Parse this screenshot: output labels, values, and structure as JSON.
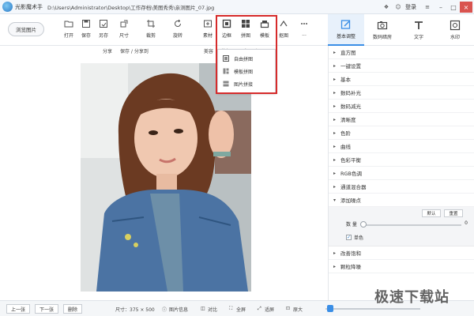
{
  "titlebar": {
    "app_name": "光影魔术手",
    "file_path": "D:\\Users\\Administrator\\Desktop\\工作存档\\美图秀秀\\亲测图片_07.jpg",
    "login": "登录",
    "minimize": "–",
    "maximize": "□",
    "close": "×"
  },
  "toolbar": {
    "browse_button": "浏览图片",
    "tools": [
      {
        "label": "打开",
        "icon": "folder-icon"
      },
      {
        "label": "保存",
        "icon": "save-icon"
      },
      {
        "label": "另存",
        "icon": "save-as-icon"
      },
      {
        "label": "尺寸",
        "icon": "resize-icon"
      },
      {
        "label": "裁剪",
        "icon": "crop-icon"
      },
      {
        "label": "旋转",
        "icon": "rotate-icon"
      },
      {
        "label": "素材",
        "icon": "material-icon"
      },
      {
        "label": "边框",
        "icon": "frame-icon"
      },
      {
        "label": "拼图",
        "icon": "collage-icon"
      },
      {
        "label": "模板",
        "icon": "template-icon"
      },
      {
        "label": "抠图",
        "icon": "cutout-icon"
      },
      {
        "label": "...",
        "icon": "more-icon"
      }
    ]
  },
  "subbar": {
    "items": [
      "分享",
      "保存 / 分享到",
      "美容",
      "修复",
      "退出",
      "还原"
    ]
  },
  "dropdown": {
    "items": [
      "自由拼图",
      "模板拼图",
      "图片拼接"
    ]
  },
  "panel_tabs": [
    {
      "label": "基本调整",
      "icon": "edit-icon",
      "active": true
    },
    {
      "label": "数码暗房",
      "icon": "camera-icon",
      "active": false
    },
    {
      "label": "文字",
      "icon": "text-icon",
      "active": false
    },
    {
      "label": "水印",
      "icon": "watermark-icon",
      "active": false
    }
  ],
  "panel": {
    "items_top": [
      "直方图",
      "一键设置",
      "基本",
      "数码补光",
      "数码减光",
      "清晰度",
      "色阶",
      "曲线",
      "色彩平衡",
      "RGB色调",
      "通道混合器",
      "添加噪点"
    ],
    "reset_label": "默认",
    "apply_label": "重置",
    "amount_label": "数 量",
    "amount_value": "0",
    "amount_ratio": 0,
    "mono_label": "单色",
    "items_bottom": [
      "改善饱和",
      "颗粒降噪"
    ]
  },
  "statusbar": {
    "prev": "上一张",
    "next": "下一张",
    "delete": "删除",
    "size_text": "尺寸：375 × 500",
    "info": "图片信息",
    "compare": "对比",
    "fullscreen": "全屏",
    "fit": "适屏",
    "original": "原大",
    "zoom_ratio": 0.05
  },
  "watermark": "极速下载站",
  "colors": {
    "accent": "#3a8ee6",
    "highlight_frame": "#d62b2b"
  }
}
